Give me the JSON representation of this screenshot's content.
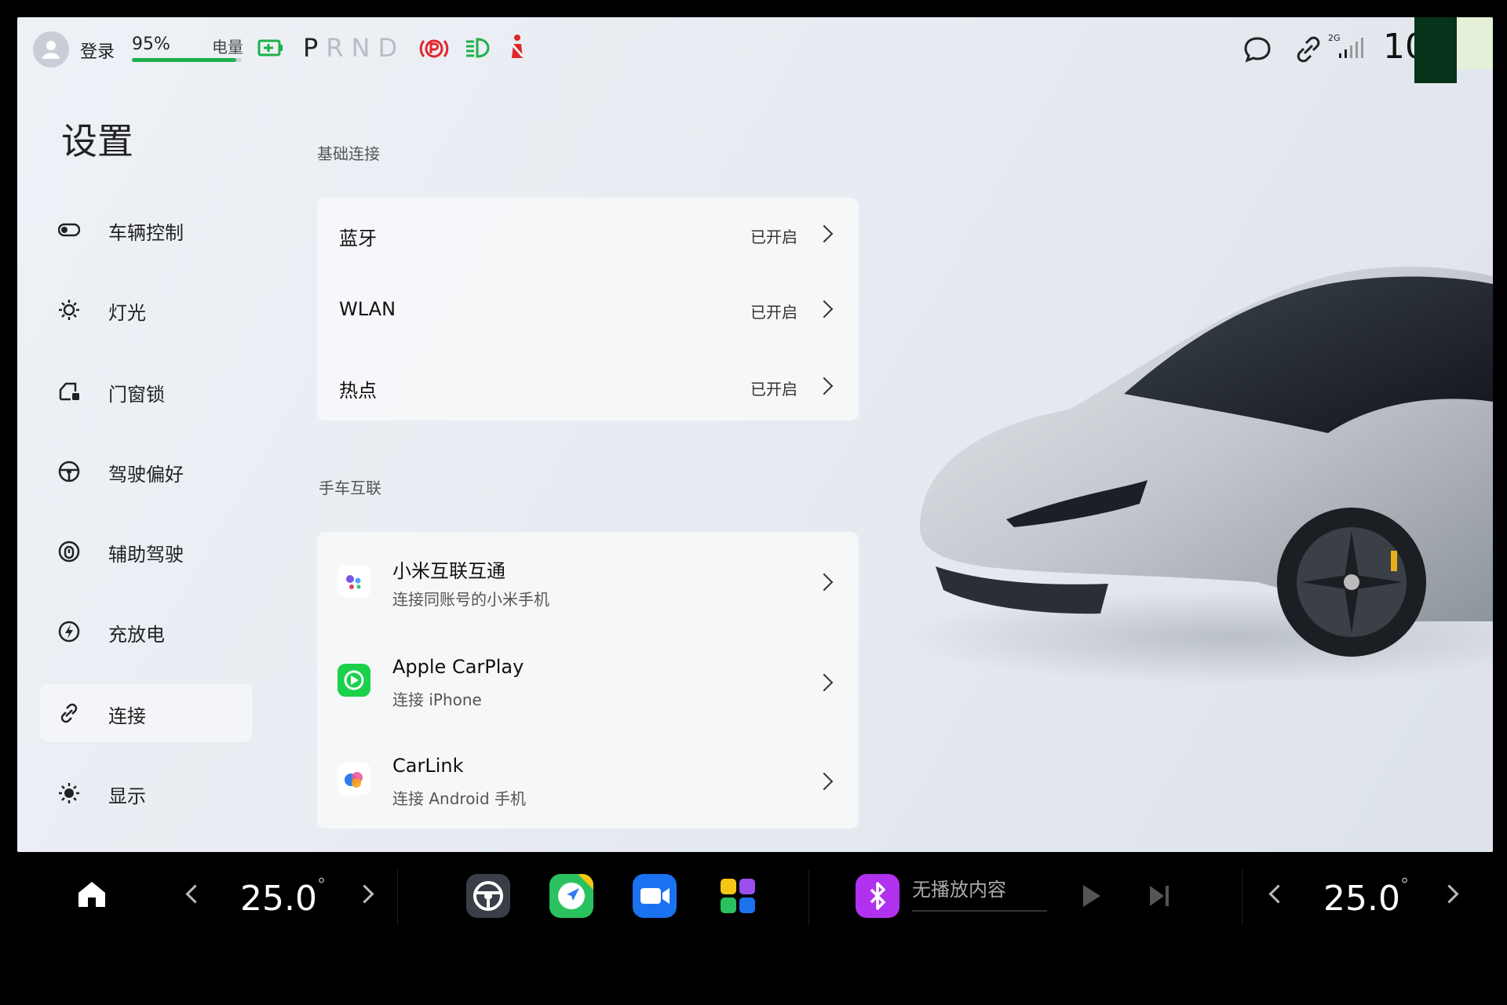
{
  "status": {
    "login_label": "登录",
    "battery_percent": "95%",
    "battery_label": "电量",
    "battery_level": 0.95,
    "gear": {
      "p": "P",
      "rnd": "RND"
    },
    "signal_label": "2G",
    "clock": "10 2"
  },
  "nav": {
    "title": "设置",
    "items": [
      {
        "label": "车辆控制",
        "icon": "toggle-icon"
      },
      {
        "label": "灯光",
        "icon": "sun-light-icon"
      },
      {
        "label": "门窗锁",
        "icon": "door-lock-icon"
      },
      {
        "label": "驾驶偏好",
        "icon": "steering-wheel-icon"
      },
      {
        "label": "辅助驾驶",
        "icon": "assist-driving-icon"
      },
      {
        "label": "充放电",
        "icon": "charge-icon"
      },
      {
        "label": "连接",
        "icon": "link-icon",
        "active": true
      },
      {
        "label": "显示",
        "icon": "brightness-icon"
      }
    ]
  },
  "basic": {
    "section": "基础连接",
    "rows": [
      {
        "label": "蓝牙",
        "value": "已开启"
      },
      {
        "label": "WLAN",
        "value": "已开启"
      },
      {
        "label": "热点",
        "value": "已开启"
      }
    ]
  },
  "phone": {
    "section": "手车互联",
    "rows": [
      {
        "title": "小米互联互通",
        "sub": "连接同账号的小米手机",
        "icon": "xiaomi-interconnect-icon"
      },
      {
        "title": "Apple CarPlay",
        "sub": "连接 iPhone",
        "icon": "carplay-icon"
      },
      {
        "title": "CarLink",
        "sub": "连接 Android 手机",
        "icon": "carlink-icon"
      }
    ]
  },
  "dock": {
    "temp_left": "25.0",
    "temp_right": "25.0",
    "deg": "°",
    "media_text": "无播放内容"
  },
  "colors": {
    "battery_green": "#1fb04a",
    "park_red": "#e0262b",
    "light_green": "#1fb04a",
    "bt_purple": "#b131ef",
    "carplay_green": "#1bd14b"
  }
}
